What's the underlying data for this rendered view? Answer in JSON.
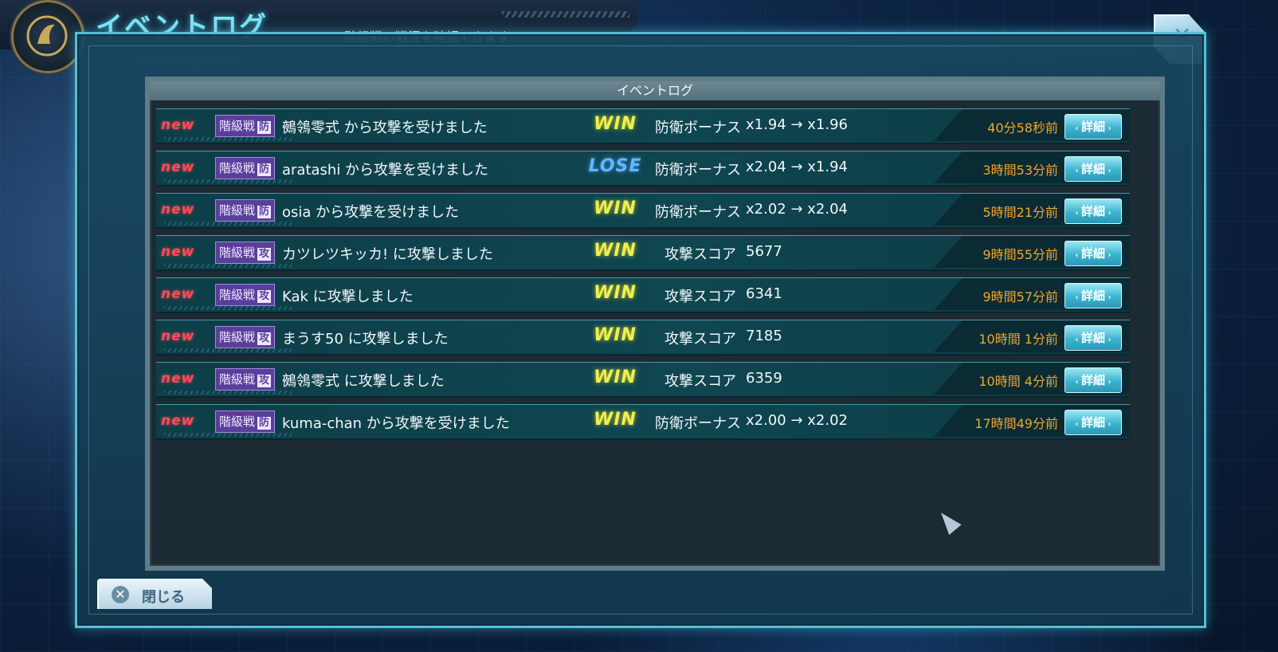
{
  "header": {
    "title": "イベントログ",
    "subtitle": "階級戦の戦況を確認できます"
  },
  "panel": {
    "title": "イベントログ"
  },
  "close_button": {
    "label": "閉じる"
  },
  "events": [
    {
      "new": "new",
      "mode": "階級戦",
      "mode_icon": "防",
      "text": "鵺鴒零式 から攻撃を受けました",
      "result": "WIN",
      "result_type": "win",
      "detail_label": "防衛ボーナス",
      "detail_value": "x1.94 → x1.96",
      "time": "40分58秒前",
      "button": "詳細"
    },
    {
      "new": "new",
      "mode": "階級戦",
      "mode_icon": "防",
      "text": "aratashi から攻撃を受けました",
      "result": "LOSE",
      "result_type": "lose",
      "detail_label": "防衛ボーナス",
      "detail_value": "x2.04 → x1.94",
      "time": "3時間53分前",
      "button": "詳細"
    },
    {
      "new": "new",
      "mode": "階級戦",
      "mode_icon": "防",
      "text": "osia から攻撃を受けました",
      "result": "WIN",
      "result_type": "win",
      "detail_label": "防衛ボーナス",
      "detail_value": "x2.02 → x2.04",
      "time": "5時間21分前",
      "button": "詳細"
    },
    {
      "new": "new",
      "mode": "階級戦",
      "mode_icon": "攻",
      "text": "カツレツキッカ! に攻撃しました",
      "result": "WIN",
      "result_type": "win",
      "detail_label": "攻撃スコア",
      "detail_value": "5677",
      "time": "9時間55分前",
      "button": "詳細"
    },
    {
      "new": "new",
      "mode": "階級戦",
      "mode_icon": "攻",
      "text": "Kak に攻撃しました",
      "result": "WIN",
      "result_type": "win",
      "detail_label": "攻撃スコア",
      "detail_value": "6341",
      "time": "9時間57分前",
      "button": "詳細"
    },
    {
      "new": "new",
      "mode": "階級戦",
      "mode_icon": "攻",
      "text": "まうす50 に攻撃しました",
      "result": "WIN",
      "result_type": "win",
      "detail_label": "攻撃スコア",
      "detail_value": "7185",
      "time": "10時間 1分前",
      "button": "詳細"
    },
    {
      "new": "new",
      "mode": "階級戦",
      "mode_icon": "攻",
      "text": "鵺鴒零式 に攻撃しました",
      "result": "WIN",
      "result_type": "win",
      "detail_label": "攻撃スコア",
      "detail_value": "6359",
      "time": "10時間 4分前",
      "button": "詳細"
    },
    {
      "new": "new",
      "mode": "階級戦",
      "mode_icon": "防",
      "text": "kuma-chan から攻撃を受けました",
      "result": "WIN",
      "result_type": "win",
      "detail_label": "防衛ボーナス",
      "detail_value": "x2.00 → x2.02",
      "time": "17時間49分前",
      "button": "詳細"
    }
  ]
}
